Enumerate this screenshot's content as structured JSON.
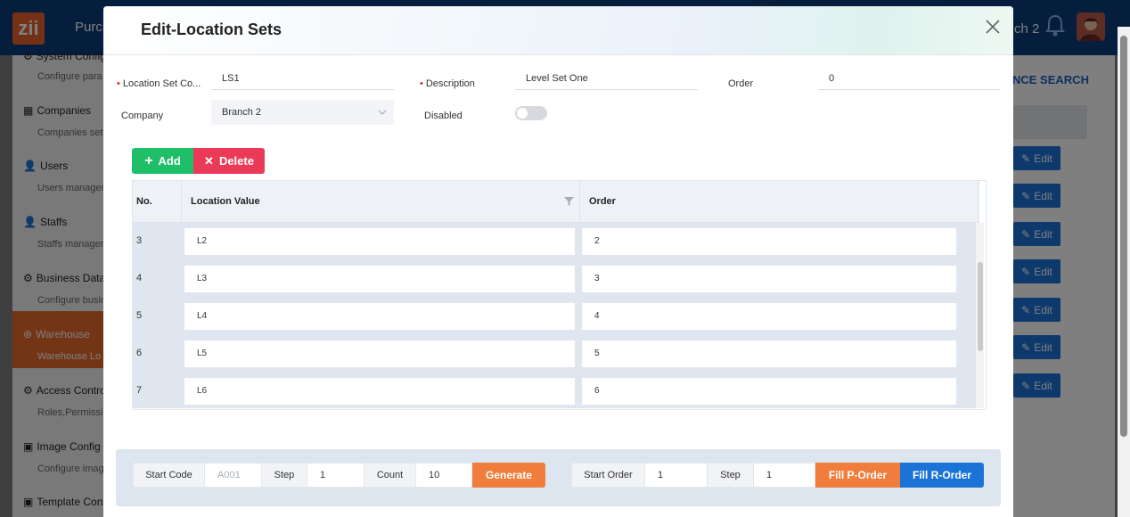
{
  "app": {
    "logo": "zii",
    "title": "Purch",
    "branch": "ch 2"
  },
  "sidebar": {
    "groups": [
      {
        "title": "System Config",
        "sub": "Configure para"
      },
      {
        "title": "Companies",
        "sub": "Companies sett"
      },
      {
        "title": "Users",
        "sub": "Users managem"
      },
      {
        "title": "Staffs",
        "sub": "Staffs manager"
      },
      {
        "title": "Business Data",
        "sub": "Configure busin"
      },
      {
        "title": "Warehouse",
        "sub": "Warehouse Lo"
      },
      {
        "title": "Access Control",
        "sub": "Roles,Permissio"
      },
      {
        "title": "Image Config",
        "sub": "Configure imag"
      },
      {
        "title": "Template Config",
        "sub": ""
      }
    ]
  },
  "right_panel": {
    "advanced_search": "NCE SEARCH",
    "edit_label": "Edit"
  },
  "modal": {
    "title": "Edit-Location Sets",
    "fields": {
      "location_set_code_label": "Location Set Co...",
      "location_set_code_value": "LS1",
      "description_label": "Description",
      "description_value": "Level Set One",
      "order_label": "Order",
      "order_value": "0",
      "company_label": "Company",
      "company_value": "Branch 2",
      "disabled_label": "Disabled",
      "disabled_on": false
    },
    "toolbar": {
      "add_label": "Add",
      "delete_label": "Delete"
    },
    "grid": {
      "columns": [
        "No.",
        "Location Value",
        "Order"
      ],
      "rows": [
        {
          "no": "3",
          "value": "L2",
          "order": "2"
        },
        {
          "no": "4",
          "value": "L3",
          "order": "3"
        },
        {
          "no": "5",
          "value": "L4",
          "order": "4"
        },
        {
          "no": "6",
          "value": "L5",
          "order": "5"
        },
        {
          "no": "7",
          "value": "L6",
          "order": "6"
        }
      ]
    },
    "footer": {
      "start_code_label": "Start Code",
      "start_code_placeholder": "A001",
      "step_label": "Step",
      "step_value": "1",
      "count_label": "Count",
      "count_value": "10",
      "generate_label": "Generate",
      "start_order_label": "Start Order",
      "start_order_value": "1",
      "step2_label": "Step",
      "step2_value": "1",
      "fill_p_label": "Fill P-Order",
      "fill_r_label": "Fill R-Order"
    }
  },
  "colors": {
    "header": "#0a3d7a",
    "accent_orange": "#f07d3c",
    "accent_blue": "#1b73d8",
    "add_green": "#1fbf6a",
    "delete_red": "#ea3a57"
  }
}
